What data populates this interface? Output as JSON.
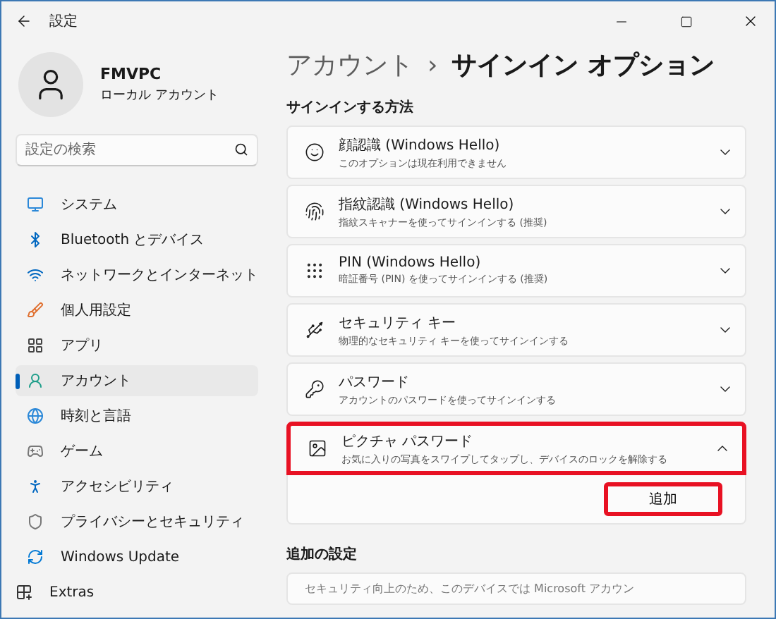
{
  "window": {
    "title": "設定"
  },
  "profile": {
    "name": "FMVPC",
    "account_type": "ローカル アカウント"
  },
  "search": {
    "placeholder": "設定の検索"
  },
  "nav": [
    {
      "label": "システム",
      "selected": false
    },
    {
      "label": "Bluetooth とデバイス",
      "selected": false
    },
    {
      "label": "ネットワークとインターネット",
      "selected": false
    },
    {
      "label": "個人用設定",
      "selected": false
    },
    {
      "label": "アプリ",
      "selected": false
    },
    {
      "label": "アカウント",
      "selected": true
    },
    {
      "label": "時刻と言語",
      "selected": false
    },
    {
      "label": "ゲーム",
      "selected": false
    },
    {
      "label": "アクセシビリティ",
      "selected": false
    },
    {
      "label": "プライバシーとセキュリティ",
      "selected": false
    },
    {
      "label": "Windows Update",
      "selected": false
    },
    {
      "label": "Extras",
      "selected": false
    }
  ],
  "breadcrumb": {
    "parent": "アカウント",
    "separator": "›",
    "current": "サインイン オプション"
  },
  "section_title": "サインインする方法",
  "sign_in_options": [
    {
      "title": "顔認識 (Windows Hello)",
      "subtitle": "このオプションは現在利用できません",
      "expanded": false,
      "highlighted": false
    },
    {
      "title": "指紋認識 (Windows Hello)",
      "subtitle": "指紋スキャナーを使ってサインインする (推奨)",
      "expanded": false,
      "highlighted": false
    },
    {
      "title": "PIN (Windows Hello)",
      "subtitle": "暗証番号 (PIN) を使ってサインインする (推奨)",
      "expanded": false,
      "highlighted": false
    },
    {
      "title": "セキュリティ キー",
      "subtitle": "物理的なセキュリティ キーを使ってサインインする",
      "expanded": false,
      "highlighted": false
    },
    {
      "title": "パスワード",
      "subtitle": "アカウントのパスワードを使ってサインインする",
      "expanded": false,
      "highlighted": false
    },
    {
      "title": "ピクチャ パスワード",
      "subtitle": "お気に入りの写真をスワイプしてタップし、デバイスのロックを解除する",
      "expanded": true,
      "highlighted": true,
      "button": {
        "label": "追加",
        "highlighted": true
      }
    }
  ],
  "additional_title": "追加の設定",
  "additional_text": "セキュリティ向上のため、このデバイスでは Microsoft アカウン"
}
